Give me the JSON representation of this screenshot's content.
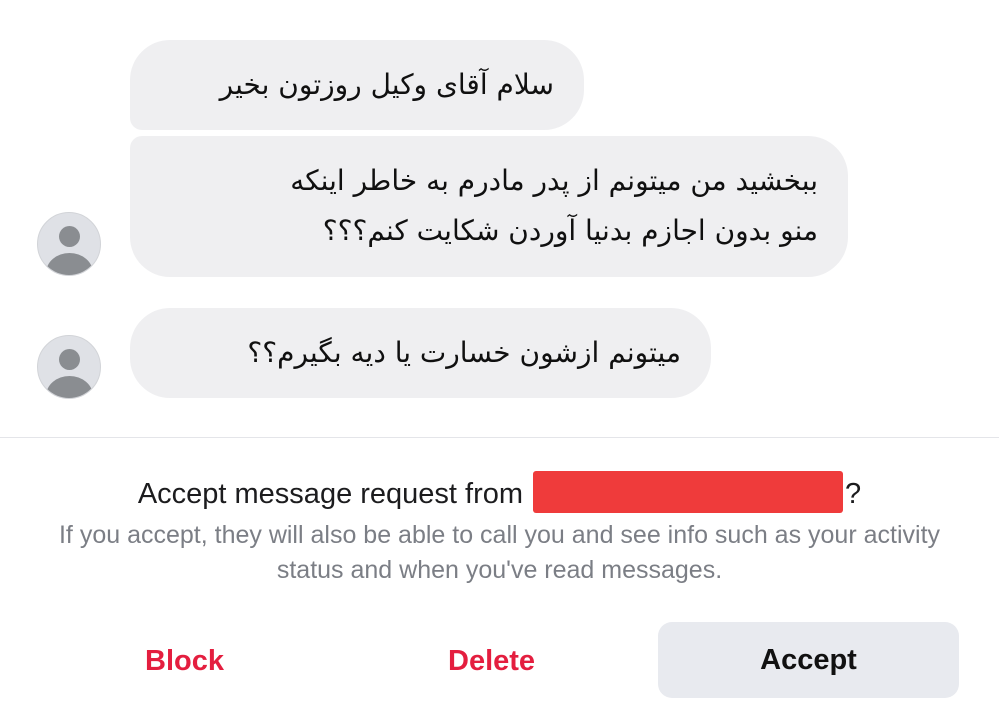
{
  "messages": [
    {
      "lines": [
        "سلام آقای وکیل روزتون بخیر"
      ]
    },
    {
      "lines": [
        "ببخشید من میتونم از پدر مادرم به خاطر اینکه",
        "منو بدون اجازم بدنیا آوردن شکایت کنم؟؟؟"
      ]
    },
    {
      "lines": [
        "میتونم ازشون خسارت یا دیه بگیرم؟؟"
      ]
    }
  ],
  "avatar_icon": "default-user-avatar-icon",
  "request": {
    "title_prefix": "Accept message request from",
    "title_suffix": "?",
    "description": "If you accept, they will also be able to call you and see info such as your activity status and when you've read messages."
  },
  "actions": {
    "block_label": "Block",
    "delete_label": "Delete",
    "accept_label": "Accept"
  },
  "colors": {
    "bubble": "#efeff1",
    "destructive": "#e41e3f",
    "accept_bg": "#e8eaef",
    "redaction": "#ef3b3b"
  }
}
